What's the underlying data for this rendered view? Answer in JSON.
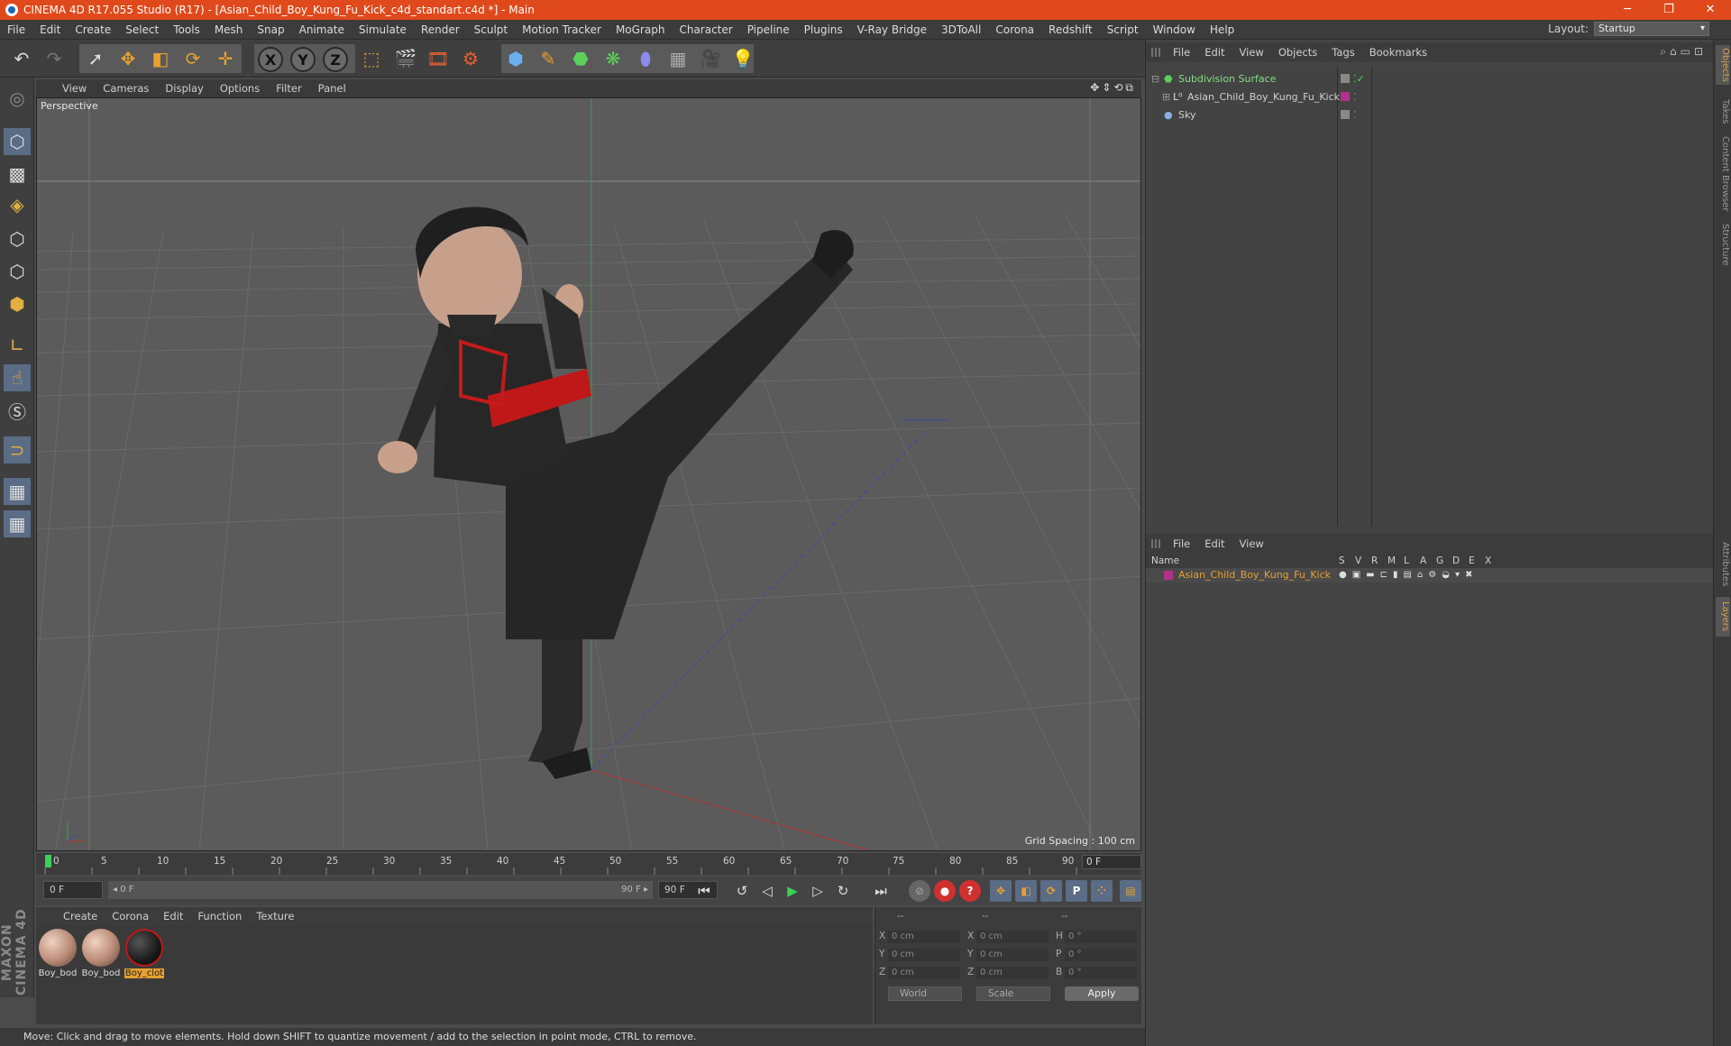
{
  "window": {
    "title": "CINEMA 4D R17.055 Studio (R17) - [Asian_Child_Boy_Kung_Fu_Kick_c4d_standart.c4d *] - Main",
    "minimize": "─",
    "restore": "❐",
    "close": "✕"
  },
  "menubar": {
    "items": [
      "File",
      "Edit",
      "Create",
      "Select",
      "Tools",
      "Mesh",
      "Snap",
      "Animate",
      "Simulate",
      "Render",
      "Sculpt",
      "Motion Tracker",
      "MoGraph",
      "Character",
      "Pipeline",
      "Plugins",
      "V-Ray Bridge",
      "3DToAll",
      "Corona",
      "Redshift",
      "Script",
      "Window",
      "Help"
    ],
    "layout_label": "Layout:",
    "layout_value": "Startup"
  },
  "toolbar": {
    "axis_x": "X",
    "axis_y": "Y",
    "axis_z": "Z"
  },
  "viewport": {
    "menu": [
      "View",
      "Cameras",
      "Display",
      "Options",
      "Filter",
      "Panel"
    ],
    "nav_icons": "✥⇕⟲⧉",
    "label": "Perspective",
    "grid_spacing": "Grid Spacing : 100 cm"
  },
  "timeline": {
    "ticks": [
      "0",
      "5",
      "10",
      "15",
      "20",
      "25",
      "30",
      "35",
      "40",
      "45",
      "50",
      "55",
      "60",
      "65",
      "70",
      "75",
      "80",
      "85",
      "90"
    ],
    "current_frame": "0 F"
  },
  "transport": {
    "start_field": "0 F",
    "range_left": "◂ 0 F",
    "range_right": "90 F ▸",
    "end_field": "90 F"
  },
  "materials": {
    "menu": [
      "Create",
      "Corona",
      "Edit",
      "Function",
      "Texture"
    ],
    "items": [
      {
        "name": "Boy_bod"
      },
      {
        "name": "Boy_bod"
      },
      {
        "name": "Boy_clot"
      }
    ]
  },
  "coordinates": {
    "header": [
      "--",
      "--",
      "--"
    ],
    "rows": [
      {
        "axis": "X",
        "pos": "0 cm",
        "size_axis": "X",
        "size": "0 cm",
        "rot_axis": "H",
        "rot": "0 °"
      },
      {
        "axis": "Y",
        "pos": "0 cm",
        "size_axis": "Y",
        "size": "0 cm",
        "rot_axis": "P",
        "rot": "0 °"
      },
      {
        "axis": "Z",
        "pos": "0 cm",
        "size_axis": "Z",
        "size": "0 cm",
        "rot_axis": "B",
        "rot": "0 °"
      }
    ],
    "mode": "World",
    "scale": "Scale",
    "apply": "Apply"
  },
  "objects_panel": {
    "menu": [
      "File",
      "Edit",
      "View",
      "Objects",
      "Tags",
      "Bookmarks"
    ],
    "items": [
      {
        "name": "Subdivision Surface",
        "color": "#7fe07f"
      },
      {
        "name": "Asian_Child_Boy_Kung_Fu_Kick",
        "color": "#cfcfcf"
      },
      {
        "name": "Sky",
        "color": "#cfcfcf"
      }
    ]
  },
  "layers_panel": {
    "menu": [
      "File",
      "Edit",
      "View"
    ],
    "name_col": "Name",
    "cols": [
      "S",
      "V",
      "R",
      "M",
      "L",
      "A",
      "G",
      "D",
      "E",
      "X"
    ],
    "layer_name": "Asian_Child_Boy_Kung_Fu_Kick",
    "layer_color": "#b0328a"
  },
  "side_tabs": {
    "top": [
      "Objects",
      "Takes",
      "Content Browser",
      "Structure"
    ],
    "bottom": [
      "Attributes",
      "Layers"
    ]
  },
  "status": "Move: Click and drag to move elements. Hold down SHIFT to quantize movement / add to the selection in point mode, CTRL to remove.",
  "branding": "MAXON CINEMA 4D",
  "colors": {
    "title_bar": "#e0491b",
    "accent_orange": "#e8a030",
    "selection_blue": "#5a6c86"
  }
}
